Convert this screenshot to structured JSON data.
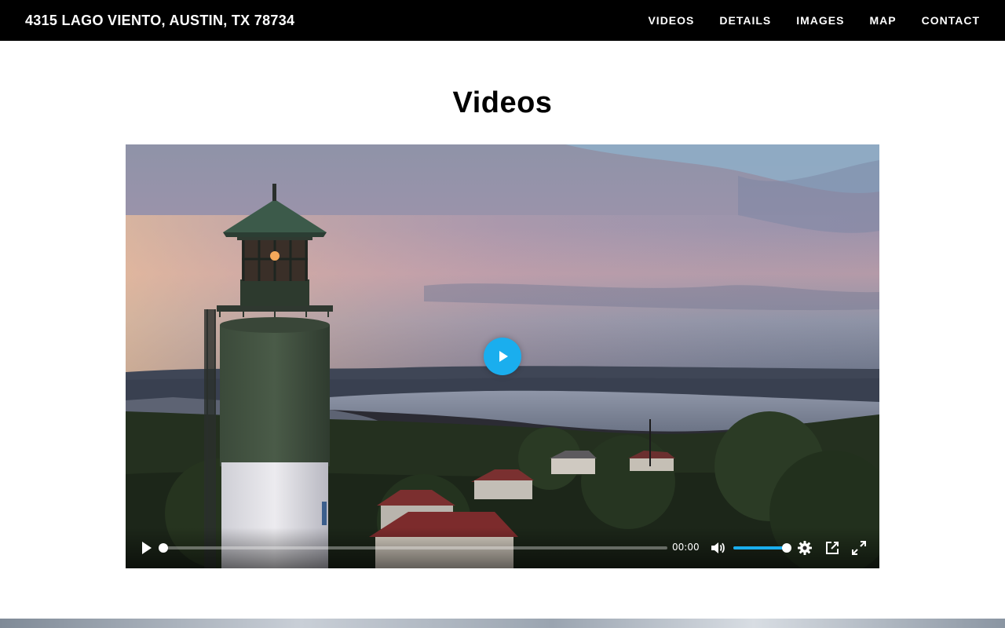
{
  "header": {
    "title": "4315 LAGO VIENTO, AUSTIN, TX 78734",
    "nav": [
      {
        "label": "VIDEOS"
      },
      {
        "label": "DETAILS"
      },
      {
        "label": "IMAGES"
      },
      {
        "label": "MAP"
      },
      {
        "label": "CONTACT"
      }
    ]
  },
  "section": {
    "title": "Videos"
  },
  "player": {
    "time": "00:00",
    "progress": 0,
    "volume": 1.0,
    "accent": "#1aaeee",
    "icons": {
      "big_play": "play-icon",
      "play": "play-icon",
      "mute": "volume-icon",
      "settings": "gear-icon",
      "pip": "picture-in-picture-icon",
      "fullscreen": "fullscreen-icon"
    }
  }
}
